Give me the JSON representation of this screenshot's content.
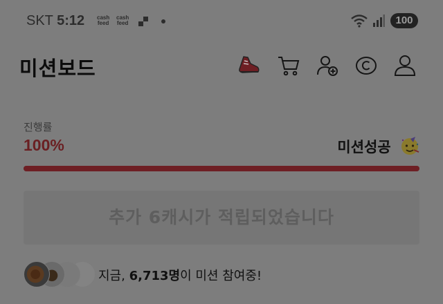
{
  "status_bar": {
    "carrier": "SKT",
    "time": "5:12",
    "app_badges": [
      {
        "line1": "cash",
        "line2": "feed"
      },
      {
        "line1": "cash",
        "line2": "feed"
      }
    ],
    "battery": "100",
    "icons": [
      "wifi-icon",
      "signal-icon"
    ]
  },
  "header": {
    "title": "미션보드",
    "icons": [
      "sneaker-icon",
      "cart-icon",
      "add-friend-icon",
      "cash-c-icon",
      "profile-icon"
    ]
  },
  "progress": {
    "label": "진행률",
    "value_text": "100%",
    "value": 1.0,
    "status_text": "미션성공",
    "status_emoji": "party-face-icon"
  },
  "banner": {
    "text": "추가 6캐시가 적립되었습니다"
  },
  "participants": {
    "prefix": "지금, ",
    "count": "6,713명",
    "suffix": "이 미션 참여중!"
  },
  "colors": {
    "overlay_bg": "#7d7d7d",
    "accent_red": "#6e1f24"
  }
}
